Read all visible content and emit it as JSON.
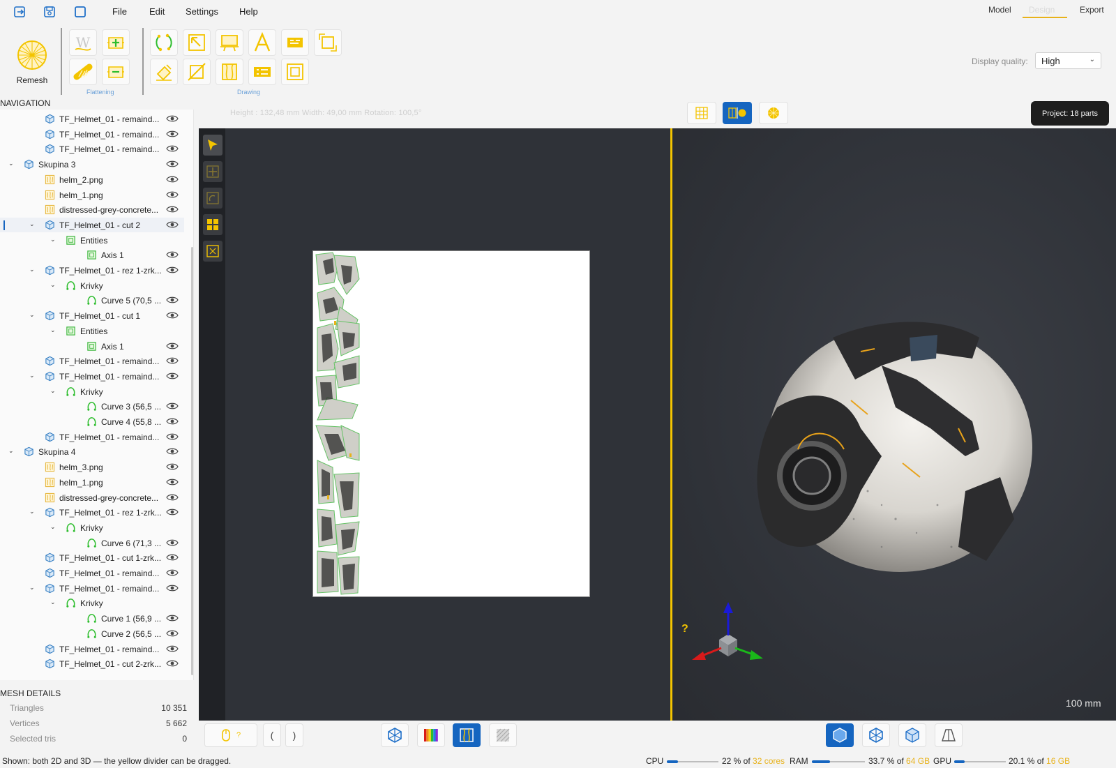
{
  "menu": {
    "file": "File",
    "edit": "Edit",
    "settings": "Settings",
    "help": "Help"
  },
  "modes": {
    "model": "Model",
    "design": "Design",
    "export": "Export",
    "active": "Design"
  },
  "ribbon": {
    "remesh_label": "Remesh",
    "group_flattening": "Flattening",
    "group_drawing": "Drawing"
  },
  "display_quality": {
    "label": "Display quality:",
    "value": "High"
  },
  "measure": {
    "text": "Height : 132,48 mm  Width: 49,00 mm  Rotation: 100,5°"
  },
  "project_badge": "Project: 18 parts",
  "navigation": {
    "title": "NAVIGATION",
    "items": [
      {
        "label": "TF_Helmet_01 - remaind...",
        "icon": "mesh",
        "indent": 1,
        "chevron": "",
        "eye": true
      },
      {
        "label": "TF_Helmet_01 - remaind...",
        "icon": "mesh",
        "indent": 1,
        "chevron": "",
        "eye": true
      },
      {
        "label": "TF_Helmet_01 - remaind...",
        "icon": "mesh",
        "indent": 1,
        "chevron": "",
        "eye": true
      },
      {
        "label": "Skupina 3",
        "icon": "mesh",
        "indent": 0,
        "chevron": "down",
        "eye": true
      },
      {
        "label": "helm_2.png",
        "icon": "image",
        "indent": 1,
        "chevron": "",
        "eye": true
      },
      {
        "label": "helm_1.png",
        "icon": "image",
        "indent": 1,
        "chevron": "",
        "eye": true
      },
      {
        "label": "distressed-grey-concrete...",
        "icon": "image",
        "indent": 1,
        "chevron": "",
        "eye": true
      },
      {
        "label": "TF_Helmet_01 - cut 2",
        "icon": "mesh",
        "indent": 1,
        "chevron": "down",
        "eye": true,
        "selected": true
      },
      {
        "label": "Entities",
        "icon": "entities",
        "indent": 2,
        "chevron": "down",
        "eye": false
      },
      {
        "label": "Axis 1",
        "icon": "entities",
        "indent": 3,
        "chevron": "",
        "eye": true
      },
      {
        "label": "TF_Helmet_01 - rez 1-zrk...",
        "icon": "mesh",
        "indent": 1,
        "chevron": "down",
        "eye": true
      },
      {
        "label": "Krivky",
        "icon": "curve",
        "indent": 2,
        "chevron": "down",
        "eye": false
      },
      {
        "label": "Curve 5  (70,5 ...",
        "icon": "curve",
        "indent": 3,
        "chevron": "",
        "eye": true
      },
      {
        "label": "TF_Helmet_01 - cut 1",
        "icon": "mesh",
        "indent": 1,
        "chevron": "down",
        "eye": true
      },
      {
        "label": "Entities",
        "icon": "entities",
        "indent": 2,
        "chevron": "down",
        "eye": false
      },
      {
        "label": "Axis 1",
        "icon": "entities",
        "indent": 3,
        "chevron": "",
        "eye": true
      },
      {
        "label": "TF_Helmet_01 - remaind...",
        "icon": "mesh",
        "indent": 1,
        "chevron": "",
        "eye": true
      },
      {
        "label": "TF_Helmet_01 - remaind...",
        "icon": "mesh",
        "indent": 1,
        "chevron": "down",
        "eye": true
      },
      {
        "label": "Krivky",
        "icon": "curve",
        "indent": 2,
        "chevron": "down",
        "eye": false
      },
      {
        "label": "Curve 3  (56,5 ...",
        "icon": "curve",
        "indent": 3,
        "chevron": "",
        "eye": true
      },
      {
        "label": "Curve 4  (55,8 ...",
        "icon": "curve",
        "indent": 3,
        "chevron": "",
        "eye": true
      },
      {
        "label": "TF_Helmet_01 - remaind...",
        "icon": "mesh",
        "indent": 1,
        "chevron": "",
        "eye": true
      },
      {
        "label": "Skupina 4",
        "icon": "mesh",
        "indent": 0,
        "chevron": "down",
        "eye": true
      },
      {
        "label": "helm_3.png",
        "icon": "image",
        "indent": 1,
        "chevron": "",
        "eye": true
      },
      {
        "label": "helm_1.png",
        "icon": "image",
        "indent": 1,
        "chevron": "",
        "eye": true
      },
      {
        "label": "distressed-grey-concrete...",
        "icon": "image",
        "indent": 1,
        "chevron": "",
        "eye": true
      },
      {
        "label": "TF_Helmet_01 - rez 1-zrk...",
        "icon": "mesh",
        "indent": 1,
        "chevron": "down",
        "eye": true
      },
      {
        "label": "Krivky",
        "icon": "curve",
        "indent": 2,
        "chevron": "down",
        "eye": false
      },
      {
        "label": "Curve 6  (71,3 ...",
        "icon": "curve",
        "indent": 3,
        "chevron": "",
        "eye": true
      },
      {
        "label": "TF_Helmet_01 - cut 1-zrk...",
        "icon": "mesh",
        "indent": 1,
        "chevron": "",
        "eye": true
      },
      {
        "label": "TF_Helmet_01 - remaind...",
        "icon": "mesh",
        "indent": 1,
        "chevron": "",
        "eye": true
      },
      {
        "label": "TF_Helmet_01 - remaind...",
        "icon": "mesh",
        "indent": 1,
        "chevron": "down",
        "eye": true
      },
      {
        "label": "Krivky",
        "icon": "curve",
        "indent": 2,
        "chevron": "down",
        "eye": false
      },
      {
        "label": "Curve 1  (56,9 ...",
        "icon": "curve",
        "indent": 3,
        "chevron": "",
        "eye": true
      },
      {
        "label": "Curve 2  (56,5 ...",
        "icon": "curve",
        "indent": 3,
        "chevron": "",
        "eye": true
      },
      {
        "label": "TF_Helmet_01 - remaind...",
        "icon": "mesh",
        "indent": 1,
        "chevron": "",
        "eye": true
      },
      {
        "label": "TF_Helmet_01 - cut 2-zrk...",
        "icon": "mesh",
        "indent": 1,
        "chevron": "",
        "eye": true
      }
    ]
  },
  "mesh_details": {
    "title": "MESH DETAILS",
    "triangles_label": "Triangles",
    "triangles": "10 351",
    "vertices_label": "Vertices",
    "vertices": "5 662",
    "selected_label": "Selected tris",
    "selected": "0"
  },
  "viewport": {
    "help_mark": "?",
    "scale": "100 mm"
  },
  "status": {
    "message": "Shown: both 2D and 3D — the yellow divider can be dragged.",
    "cpu_label": "CPU",
    "cpu_value": "22 % of ",
    "cpu_total": "32 cores",
    "cpu_fraction": 0.22,
    "ram_label": "RAM",
    "ram_value": "33.7 % of ",
    "ram_total": "64 GB",
    "ram_fraction": 0.337,
    "gpu_label": "GPU",
    "gpu_value": "20.1 % of ",
    "gpu_total": "16 GB",
    "gpu_fraction": 0.201
  },
  "bottom_toolbar": {
    "mouse_hint": "?",
    "bracket_left": "(",
    "bracket_right": ")"
  },
  "colors": {
    "accent": "#1565c0",
    "yellow": "#f3c400",
    "highlight": "#e8b21a"
  }
}
